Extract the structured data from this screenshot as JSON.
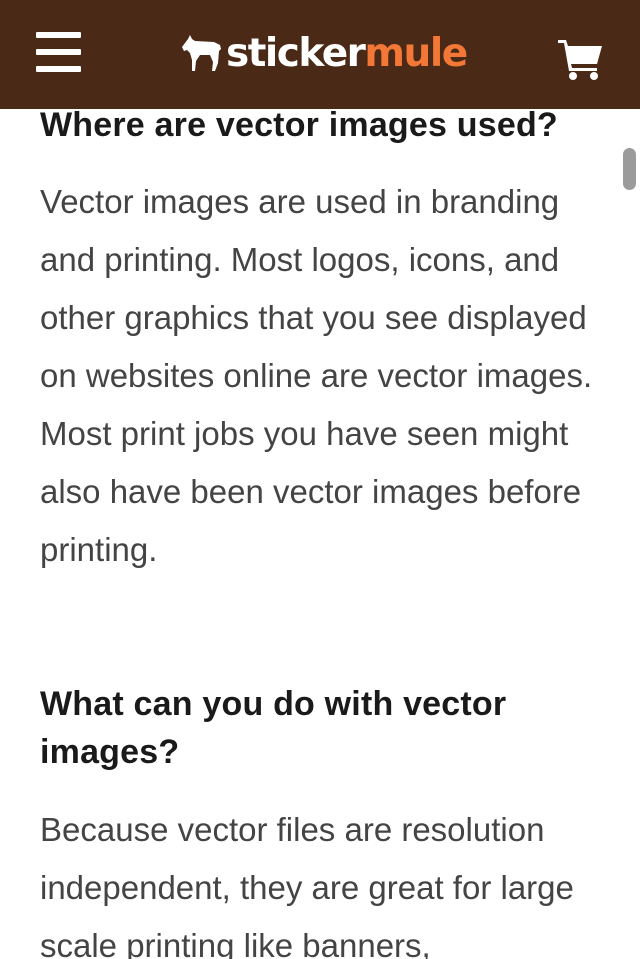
{
  "header": {
    "brand_part1": "sticker",
    "brand_part2": "mule",
    "menu_icon": "hamburger-menu-icon",
    "cart_icon": "cart-icon",
    "background_color": "#4a2a17",
    "accent_color": "#f37736"
  },
  "article": {
    "section1": {
      "heading": "Where are vector images used?",
      "body": "Vector images are used in branding and printing. Most logos, icons, and other graphics that you see displayed on websites online are vector images. Most print jobs you have seen might also have been vector images before printing."
    },
    "section2": {
      "heading": "What can you do with vector images?",
      "body": "Because vector files are resolution independent, they are great for large scale printing like banners,"
    }
  }
}
